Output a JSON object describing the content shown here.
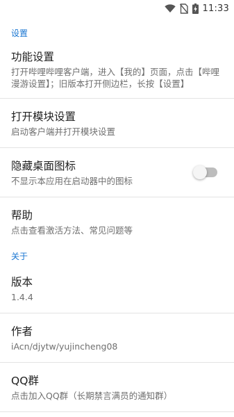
{
  "status_bar": {
    "time": "11:33",
    "icons": [
      "wifi-icon",
      "no-sim-icon",
      "battery-charging-icon"
    ]
  },
  "sections": {
    "settings": {
      "header": "设置",
      "items": [
        {
          "title": "功能设置",
          "summary": "打开哔哩哔哩客户端，进入【我的】页面，点击【哔哩漫游设置】；旧版本打开侧边栏，长按【设置】"
        },
        {
          "title": "打开模块设置",
          "summary": "启动客户端并打开模块设置"
        },
        {
          "title": "隐藏桌面图标",
          "summary": "不显示本应用在启动器中的图标",
          "switch_on": false
        },
        {
          "title": "帮助",
          "summary": "点击查看激活方法、常见问题等"
        }
      ]
    },
    "about": {
      "header": "关于",
      "items": [
        {
          "title": "版本",
          "summary": "1.4.4"
        },
        {
          "title": "作者",
          "summary": "iAcn/djytw/yujincheng08"
        },
        {
          "title": "QQ群",
          "summary": "点击加入QQ群（长期禁言满员的通知群）"
        }
      ]
    }
  },
  "colors": {
    "accent": "#1976d2",
    "title_text": "#212121",
    "summary_text": "#6f6f6f",
    "divider": "#e3e3e3",
    "switch_track_off": "#bdbdbd",
    "switch_thumb_off": "#f5f5f5"
  }
}
